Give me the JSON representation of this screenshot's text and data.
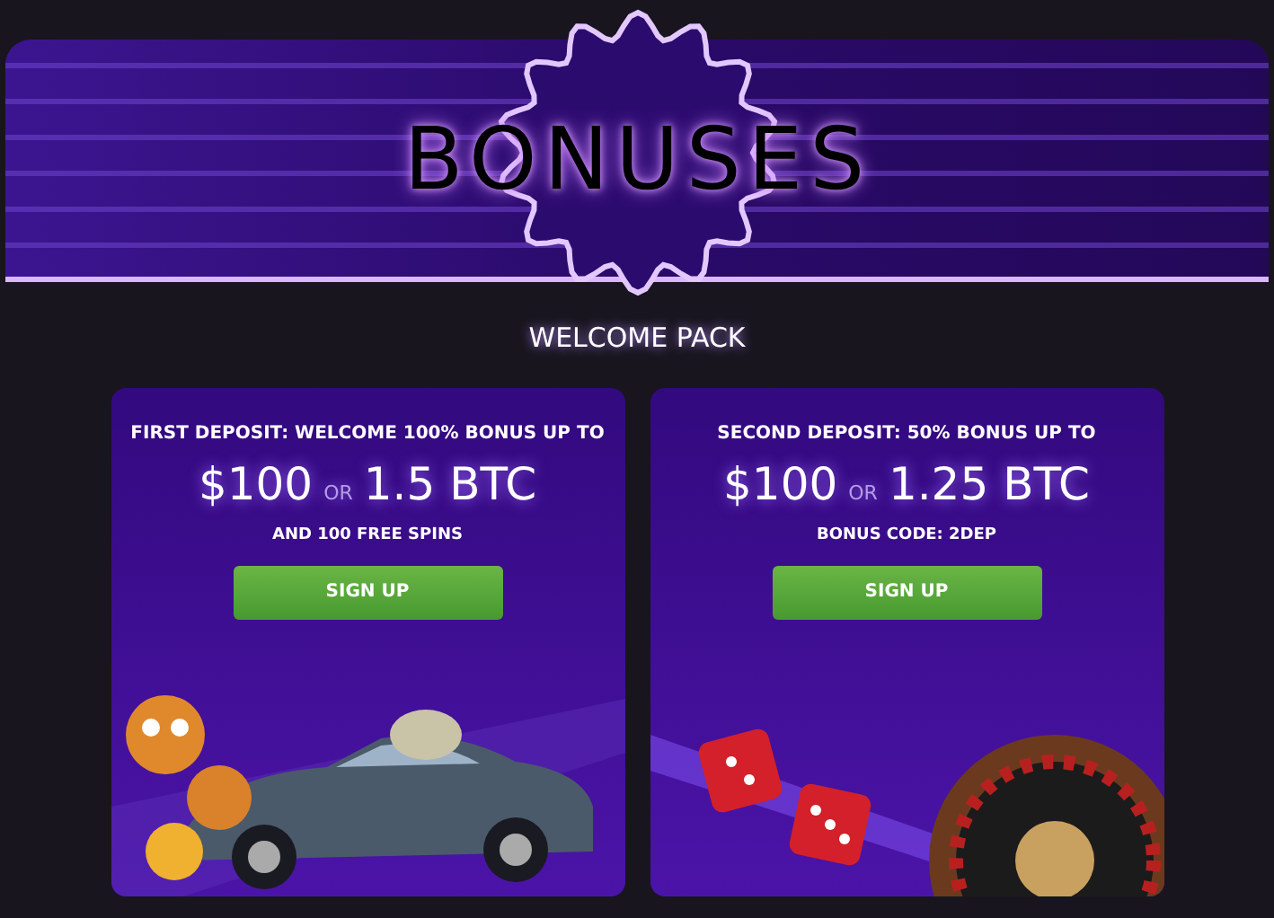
{
  "banner": {
    "title": "BONUSES"
  },
  "section": {
    "title": "WELCOME PACK"
  },
  "cards": [
    {
      "kind": "car",
      "heading": "FIRST DEPOSIT: WELCOME 100% BONUS UP TO",
      "amount": "$100",
      "separator": "OR",
      "alt_amount": "1.5 BTC",
      "note": "AND 100 FREE SPINS",
      "button": "SIGN UP"
    },
    {
      "kind": "casino",
      "heading": "SECOND DEPOSIT: 50% BONUS UP TO",
      "amount": "$100",
      "separator": "OR",
      "alt_amount": "1.25 BTC",
      "note": "BONUS CODE: 2DEP",
      "button": "SIGN UP"
    }
  ]
}
